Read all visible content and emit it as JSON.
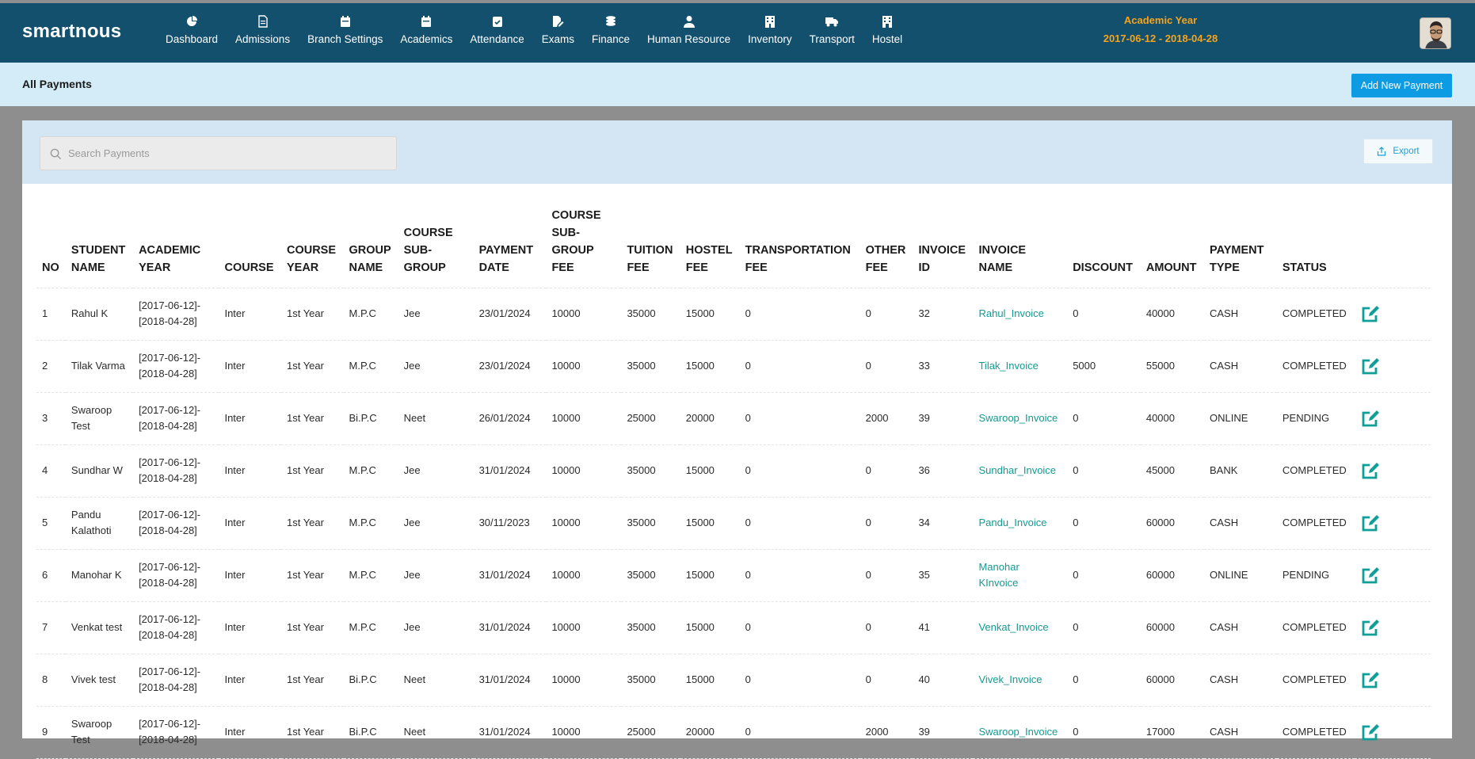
{
  "brand": "smartnous",
  "nav": [
    {
      "icon": "dashboard-icon",
      "label": "Dashboard"
    },
    {
      "icon": "document-icon",
      "label": "Admissions"
    },
    {
      "icon": "calendar-icon",
      "label": "Branch Settings"
    },
    {
      "icon": "calendar-icon",
      "label": "Academics"
    },
    {
      "icon": "clipboard-check-icon",
      "label": "Attendance"
    },
    {
      "icon": "pen-paper-icon",
      "label": "Exams"
    },
    {
      "icon": "coins-icon",
      "label": "Finance"
    },
    {
      "icon": "user-tie-icon",
      "label": "Human Resource"
    },
    {
      "icon": "building-icon",
      "label": "Inventory"
    },
    {
      "icon": "truck-icon",
      "label": "Transport"
    },
    {
      "icon": "hostel-icon",
      "label": "Hostel"
    }
  ],
  "academic_year": {
    "label": "Academic Year",
    "value": "2017-06-12 - 2018-04-28"
  },
  "page": {
    "title": "All Payments",
    "add_button": "Add New Payment"
  },
  "search": {
    "placeholder": "Search Payments"
  },
  "export_label": "Export",
  "colors": {
    "nav_bg": "#13506e",
    "accent": "#0d9be3",
    "link": "#139a92",
    "academic_year": "#f5a31a",
    "edit_icon": "#109f97"
  },
  "table": {
    "headers": [
      "NO",
      "STUDENT NAME",
      "ACADEMIC YEAR",
      "COURSE",
      "COURSE YEAR",
      "GROUP NAME",
      "COURSE SUB-GROUP",
      "PAYMENT DATE",
      "COURSE SUB-GROUP FEE",
      "TUITION FEE",
      "HOSTEL FEE",
      "TRANSPORTATION FEE",
      "OTHER FEE",
      "INVOICE ID",
      "INVOICE NAME",
      "DISCOUNT",
      "AMOUNT",
      "PAYMENT TYPE",
      "STATUS",
      ""
    ],
    "rows": [
      [
        "1",
        "Rahul K",
        "[2017-06-12]-[2018-04-28]",
        "Inter",
        "1st Year",
        "M.P.C",
        "Jee",
        "23/01/2024",
        "10000",
        "35000",
        "15000",
        "0",
        "0",
        "32",
        "Rahul_Invoice",
        "0",
        "40000",
        "CASH",
        "COMPLETED"
      ],
      [
        "2",
        "Tilak Varma",
        "[2017-06-12]-[2018-04-28]",
        "Inter",
        "1st Year",
        "M.P.C",
        "Jee",
        "23/01/2024",
        "10000",
        "35000",
        "15000",
        "0",
        "0",
        "33",
        "Tilak_Invoice",
        "5000",
        "55000",
        "CASH",
        "COMPLETED"
      ],
      [
        "3",
        "Swaroop Test",
        "[2017-06-12]-[2018-04-28]",
        "Inter",
        "1st Year",
        "Bi.P.C",
        "Neet",
        "26/01/2024",
        "10000",
        "25000",
        "20000",
        "0",
        "2000",
        "39",
        "Swaroop_Invoice",
        "0",
        "40000",
        "ONLINE",
        "PENDING"
      ],
      [
        "4",
        "Sundhar W",
        "[2017-06-12]-[2018-04-28]",
        "Inter",
        "1st Year",
        "M.P.C",
        "Jee",
        "31/01/2024",
        "10000",
        "35000",
        "15000",
        "0",
        "0",
        "36",
        "Sundhar_Invoice",
        "0",
        "45000",
        "BANK",
        "COMPLETED"
      ],
      [
        "5",
        "Pandu Kalathoti",
        "[2017-06-12]-[2018-04-28]",
        "Inter",
        "1st Year",
        "M.P.C",
        "Jee",
        "30/11/2023",
        "10000",
        "35000",
        "15000",
        "0",
        "0",
        "34",
        "Pandu_Invoice",
        "0",
        "60000",
        "CASH",
        "COMPLETED"
      ],
      [
        "6",
        "Manohar K",
        "[2017-06-12]-[2018-04-28]",
        "Inter",
        "1st Year",
        "M.P.C",
        "Jee",
        "31/01/2024",
        "10000",
        "35000",
        "15000",
        "0",
        "0",
        "35",
        "Manohar KInvoice",
        "0",
        "60000",
        "ONLINE",
        "PENDING"
      ],
      [
        "7",
        "Venkat test",
        "[2017-06-12]-[2018-04-28]",
        "Inter",
        "1st Year",
        "M.P.C",
        "Jee",
        "31/01/2024",
        "10000",
        "35000",
        "15000",
        "0",
        "0",
        "41",
        "Venkat_Invoice",
        "0",
        "60000",
        "CASH",
        "COMPLETED"
      ],
      [
        "8",
        "Vivek test",
        "[2017-06-12]-[2018-04-28]",
        "Inter",
        "1st Year",
        "Bi.P.C",
        "Neet",
        "31/01/2024",
        "10000",
        "35000",
        "15000",
        "0",
        "0",
        "40",
        "Vivek_Invoice",
        "0",
        "60000",
        "CASH",
        "COMPLETED"
      ],
      [
        "9",
        "Swaroop Test",
        "[2017-06-12]-[2018-04-28]",
        "Inter",
        "1st Year",
        "Bi.P.C",
        "Neet",
        "31/01/2024",
        "10000",
        "25000",
        "20000",
        "0",
        "2000",
        "39",
        "Swaroop_Invoice",
        "0",
        "17000",
        "CASH",
        "COMPLETED"
      ]
    ]
  }
}
